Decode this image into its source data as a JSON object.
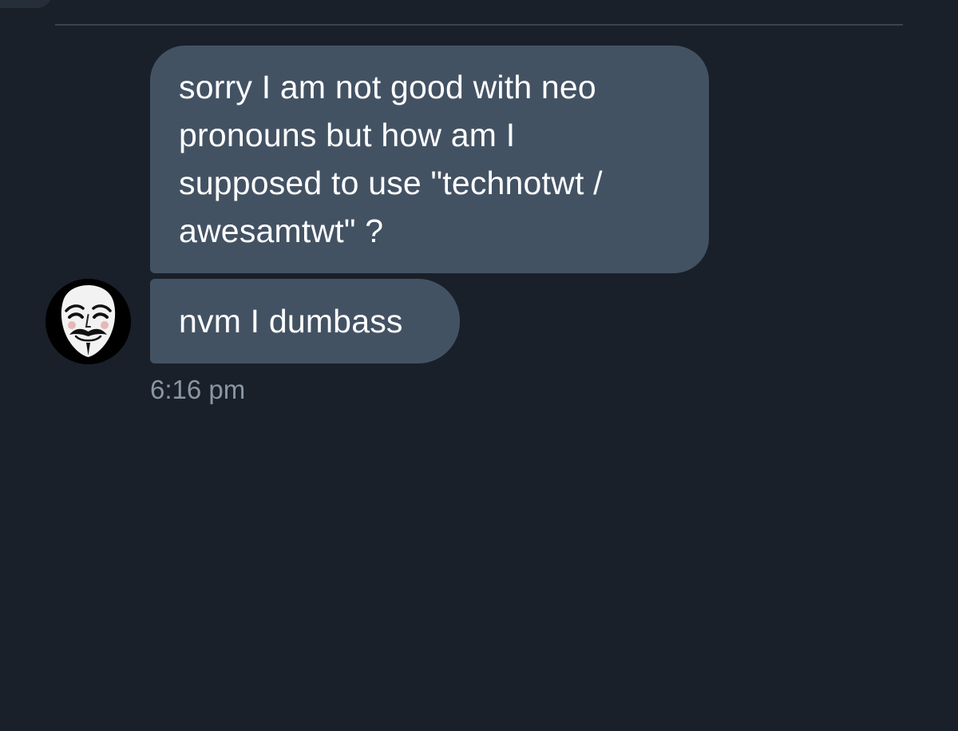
{
  "conversation": {
    "messages": [
      {
        "text": "sorry I am not good with neo\npronouns but how am I\nsupposed to use \"technotwt /\nawesamtwt\" ?"
      },
      {
        "text": "nvm I dumbass"
      }
    ],
    "timestamp": "6:16 pm",
    "avatar_icon": "guy-fawkes-mask-icon"
  },
  "colors": {
    "background": "#19202a",
    "bubble": "#435263",
    "bubble_text": "#ffffff",
    "timestamp_text": "#8a96a3",
    "divider": "#3a4350"
  }
}
